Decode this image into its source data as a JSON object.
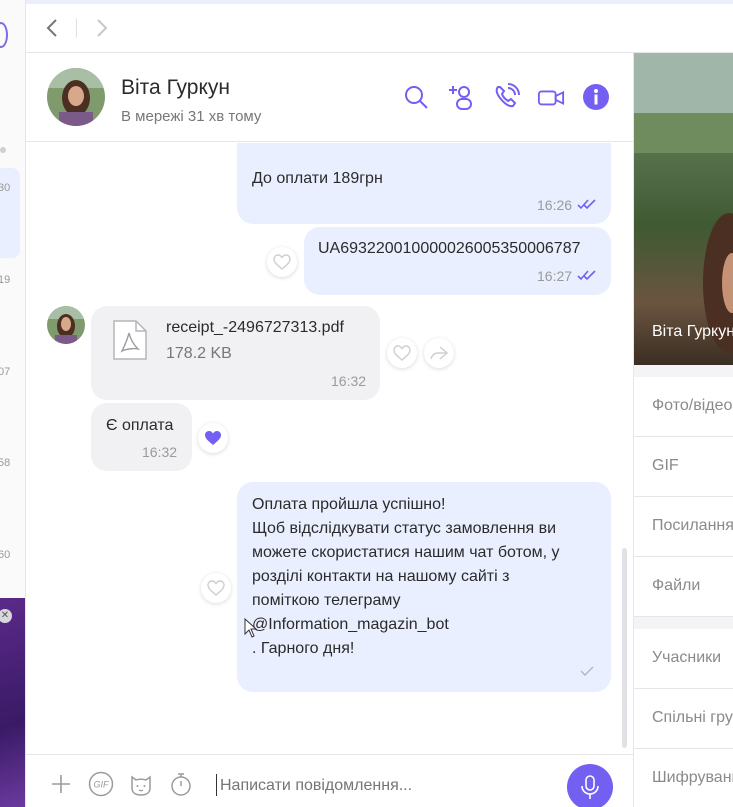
{
  "nav": {
    "back_label": "‹",
    "forward_label": "›"
  },
  "left_list": {
    "times": [
      "30",
      "19",
      "07",
      "58",
      "60"
    ]
  },
  "header": {
    "name": "Віта Гуркун",
    "status": "В мережі 31 хв тому",
    "icons": [
      "search-icon",
      "add-participant-icon",
      "call-icon",
      "video-call-icon",
      "info-icon"
    ]
  },
  "colors": {
    "accent": "#7360f2",
    "outgoing_bubble": "#e9efff",
    "incoming_bubble": "#f1f1f3"
  },
  "messages": [
    {
      "direction": "out",
      "text": "До оплати 189грн",
      "time": "16:26",
      "status": "read"
    },
    {
      "direction": "out",
      "text": "UA693220010000026005350006787",
      "time": "16:27",
      "status": "read"
    },
    {
      "direction": "in",
      "type": "file",
      "file_name": "receipt_-2496727313.pdf",
      "file_size": "178.2 KB",
      "time": "16:32"
    },
    {
      "direction": "in",
      "text": "Є оплата",
      "time": "16:32",
      "reaction": "heart"
    },
    {
      "direction": "out",
      "text": "Оплата пройшла успішно!\nЩоб відслідкувати статус замовлення ви\nможете скористатися нашим чат ботом, у\nрозділі контакти на нашому сайті з\nпоміткою телеграму\n@Information_magazin_bot\n. Гарного дня!",
      "status": "sent"
    }
  ],
  "composer": {
    "placeholder": "Написати повідомлення..."
  },
  "info_panel": {
    "photo_caption": "Віта Гуркун",
    "sections": [
      "Фото/відео",
      "GIF",
      "Посилання",
      "Файли"
    ],
    "sections2": [
      "Учасники",
      "Спільні групи",
      "Шифрування"
    ]
  }
}
